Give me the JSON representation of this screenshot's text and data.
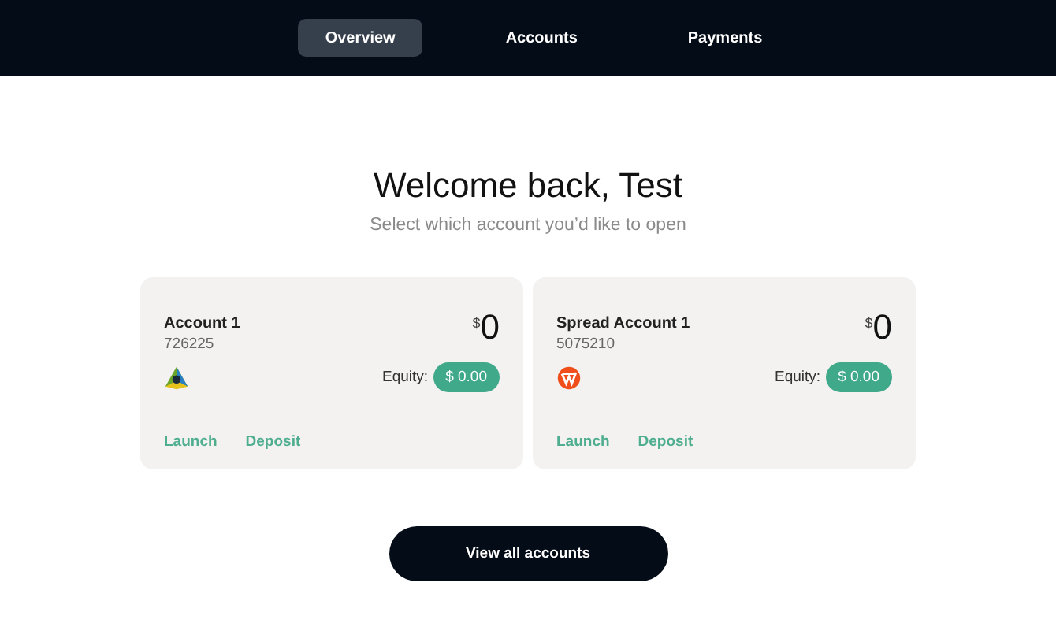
{
  "nav": {
    "tabs": [
      {
        "label": "Overview",
        "selected": true
      },
      {
        "label": "Accounts",
        "selected": false
      },
      {
        "label": "Payments",
        "selected": false
      }
    ]
  },
  "heading": "Welcome back, Test",
  "subheading": "Select which account you’d like to open",
  "accounts": [
    {
      "name": "Account 1",
      "number": "726225",
      "kind": "mt",
      "currency": "$",
      "balance": "0",
      "equity_label": "Equity:",
      "equity": "$ 0.00",
      "actions": [
        "Launch",
        "Deposit"
      ]
    },
    {
      "name": "Spread Account 1",
      "number": "5075210",
      "kind": "spread",
      "currency": "$",
      "balance": "0",
      "equity_label": "Equity:",
      "equity": "$ 0.00",
      "actions": [
        "Launch",
        "Deposit"
      ]
    }
  ],
  "view_all": "View all accounts"
}
